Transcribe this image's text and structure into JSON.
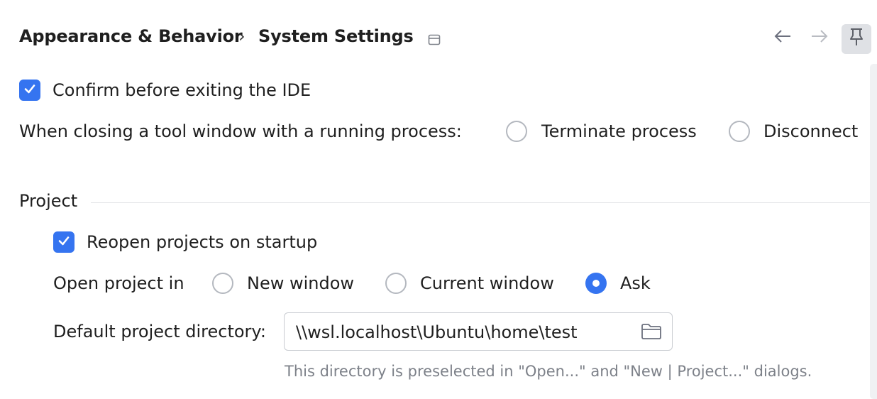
{
  "header": {
    "breadcrumb_parent": "Appearance & Behavior",
    "breadcrumb_separator": "›",
    "breadcrumb_current": "System Settings"
  },
  "general": {
    "confirm_exit_label": "Confirm before exiting the IDE",
    "confirm_exit_checked": true,
    "closing_tool_window_label": "When closing a tool window with a running process:",
    "closing_options": [
      {
        "label": "Terminate process",
        "selected": false
      },
      {
        "label": "Disconnect",
        "selected": false
      }
    ]
  },
  "project": {
    "section_title": "Project",
    "reopen_label": "Reopen projects on startup",
    "reopen_checked": true,
    "open_in_label": "Open project in",
    "open_in_options": [
      {
        "label": "New window",
        "selected": false
      },
      {
        "label": "Current window",
        "selected": false
      },
      {
        "label": "Ask",
        "selected": true
      }
    ],
    "default_dir_label": "Default project directory:",
    "default_dir_value": "\\\\wsl.localhost\\Ubuntu\\home\\test",
    "default_dir_hint": "This directory is preselected in \"Open...\" and \"New | Project...\" dialogs."
  },
  "colors": {
    "accent": "#3574f0",
    "hint_text": "#7d8189",
    "border": "#c9ccd1"
  },
  "icons": {
    "window_icon": "window-icon",
    "back": "arrow-left-icon",
    "forward": "arrow-right-icon",
    "pin": "pin-icon",
    "folder": "folder-icon",
    "check": "checkmark-icon"
  }
}
